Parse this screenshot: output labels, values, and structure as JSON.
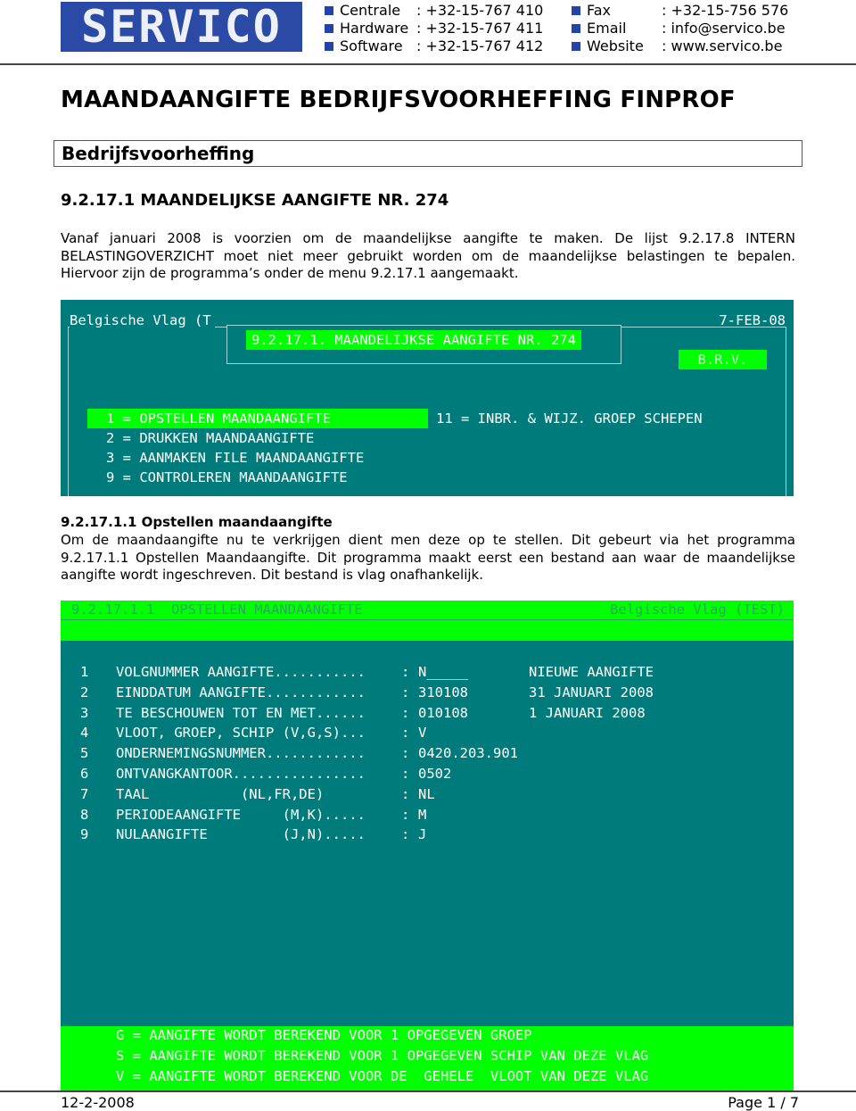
{
  "header": {
    "logo_text": "SERVICO",
    "contacts_left": [
      {
        "label": "Centrale",
        "value": ": +32-15-767 410"
      },
      {
        "label": "Hardware",
        "value": ": +32-15-767 411"
      },
      {
        "label": "Software",
        "value": ": +32-15-767 412"
      }
    ],
    "contacts_right": [
      {
        "label": "Fax",
        "value": ": +32-15-756 576"
      },
      {
        "label": "Email",
        "value": ": info@servico.be"
      },
      {
        "label": "Website",
        "value": ": www.servico.be"
      }
    ],
    "colors": {
      "brand_blue": "#2a4aa6"
    }
  },
  "document": {
    "title": "MAANDAANGIFTE BEDRIJFSVOORHEFFING FINPROF",
    "section": "Bedrijfsvoorheffing",
    "subtitle": "9.2.17.1 MAANDELIJKSE AANGIFTE NR. 274",
    "intro": "Vanaf januari 2008 is voorzien om de maandelijkse aangifte te maken. De lijst 9.2.17.8 INTERN BELASTINGOVERZICHT moet niet meer gebruikt worden om de maandelijkse belastingen te bepalen. Hiervoor zijn de programma’s onder de menu 9.2.17.1 aangemaakt.",
    "sub_heading": "9.2.17.1.1 Opstellen maandaangifte",
    "sub_text": "Om de maandaangifte nu te verkrijgen dient men deze op te stellen. Dit gebeurt via het programma 9.2.17.1.1 Opstellen Maandaangifte. Dit programma maakt eerst een bestand aan waar de maandelijkse aangifte wordt ingeschreven. Dit bestand is vlag onafhankelijk."
  },
  "screen1": {
    "flag": "Belgische Vlag (T",
    "date": "7-FEB-08",
    "menu_title": "9.2.17.1. MAANDELIJKSE AANGIFTE NR. 274",
    "badge": "B.R.V.",
    "menu_items": [
      "1 = OPSTELLEN MAANDAANGIFTE",
      "2 = DRUKKEN MAANDAANGIFTE",
      "3 = AANMAKEN FILE MAANDAANGIFTE",
      "9 = CONTROLEREN MAANDAANGIFTE"
    ],
    "menu_item_right": "11 = INBR. & WIJZ. GROEP SCHEPEN",
    "selected_index": 0,
    "colors": {
      "background": "#007b7b",
      "highlight": "#00ff00"
    }
  },
  "screen2": {
    "program": "9.2.17.1.1  OPSTELLEN MAANDAANGIFTE",
    "flag": "Belgische Vlag (TEST)",
    "fields": [
      {
        "nr": "1",
        "label": "VOLGNUMMER AANGIFTE...........",
        "value": "N_____",
        "desc": "NIEUWE AANGIFTE"
      },
      {
        "nr": "2",
        "label": "EINDDATUM AANGIFTE............",
        "value": "310108",
        "desc": "31 JANUARI 2008"
      },
      {
        "nr": "3",
        "label": "TE BESCHOUWEN TOT EN MET......",
        "value": "010108",
        "desc": "1 JANUARI 2008"
      },
      {
        "nr": "4",
        "label": "VLOOT, GROEP, SCHIP (V,G,S)...",
        "value": "V",
        "desc": ""
      },
      {
        "nr": "5",
        "label": "ONDERNEMINGSNUMMER............",
        "value": "0420.203.901",
        "desc": ""
      },
      {
        "nr": "6",
        "label": "ONTVANGKANTOOR................",
        "value": "0502",
        "desc": ""
      },
      {
        "nr": "7",
        "label": "TAAL           (NL,FR,DE)",
        "value": "NL",
        "desc": ""
      },
      {
        "nr": "8",
        "label": "PERIODEAANGIFTE     (M,K).....",
        "value": "M",
        "desc": ""
      },
      {
        "nr": "9",
        "label": "NULAANGIFTE         (J,N).....",
        "value": "J",
        "desc": ""
      }
    ],
    "help_lines": [
      "G = AANGIFTE WORDT BEREKEND VOOR 1 OPGEGEVEN GROEP",
      "S = AANGIFTE WORDT BEREKEND VOOR 1 OPGEGEVEN SCHIP VAN DEZE VLAG",
      "V = AANGIFTE WORDT BEREKEND VOOR DE  GEHELE  VLOOT VAN DEZE VLAG"
    ]
  },
  "footer": {
    "date": "12-2-2008",
    "page": "Page 1 / 7"
  }
}
